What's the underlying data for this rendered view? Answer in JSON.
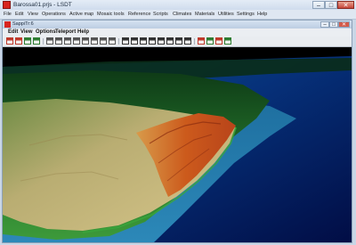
{
  "window": {
    "title": "Barossa01.prjs - LSDT",
    "controls": {
      "minimize": "–",
      "maximize": "□",
      "close": "✕"
    }
  },
  "menubar": {
    "items": [
      "File",
      "Edit",
      "View",
      "Operations",
      "Active map",
      "Mosaic tools",
      "Reference",
      "Scripts",
      "Climates",
      "Materials",
      "Utilities",
      "Settings",
      "Help"
    ]
  },
  "child_window": {
    "title": "SappiTr:6",
    "menu": [
      "Edit",
      "View",
      "Options",
      "Teleport",
      "Help"
    ],
    "controls": {
      "minimize": "–",
      "maximize": "□",
      "close": "✕"
    }
  },
  "toolbar": {
    "buttons": [
      {
        "icon": "undo-icon",
        "color": "#c0392b"
      },
      {
        "icon": "redo-icon",
        "color": "#c0392b"
      },
      {
        "icon": "camera-icon",
        "color": "#2e7d32"
      },
      {
        "icon": "save-view-icon",
        "color": "#2e7d32"
      },
      {
        "icon": "select-icon",
        "color": "#555555"
      },
      {
        "icon": "move-icon",
        "color": "#555555"
      },
      {
        "icon": "rotate-icon",
        "color": "#555555"
      },
      {
        "icon": "zoom-icon",
        "color": "#555555"
      },
      {
        "icon": "pan-icon",
        "color": "#555555"
      },
      {
        "icon": "fly-icon",
        "color": "#555555"
      },
      {
        "icon": "walk-icon",
        "color": "#555555"
      },
      {
        "icon": "orbit-icon",
        "color": "#555555"
      },
      {
        "icon": "grid-icon",
        "color": "#333333"
      },
      {
        "icon": "wireframe-icon",
        "color": "#333333"
      },
      {
        "icon": "render-icon",
        "color": "#333333"
      },
      {
        "icon": "texture-icon",
        "color": "#333333"
      },
      {
        "icon": "lighting-icon",
        "color": "#333333"
      },
      {
        "icon": "fog-icon",
        "color": "#333333"
      },
      {
        "icon": "sky-icon",
        "color": "#333333"
      },
      {
        "icon": "water-icon",
        "color": "#333333"
      },
      {
        "icon": "marker-red-icon",
        "color": "#c0392b"
      },
      {
        "icon": "marker-green-icon",
        "color": "#2e7d32"
      },
      {
        "icon": "flag-icon",
        "color": "#c0392b"
      },
      {
        "icon": "export-icon",
        "color": "#2e7d32"
      }
    ]
  },
  "viewport": {
    "content": "3D terrain render",
    "colors": {
      "ocean_deep": "#02124a",
      "ocean_shallow": "#1f78a8",
      "lowland": "#2f8f2f",
      "plateau": "#c9b77a",
      "ridge": "#c8501a",
      "sky": "#000000"
    }
  }
}
